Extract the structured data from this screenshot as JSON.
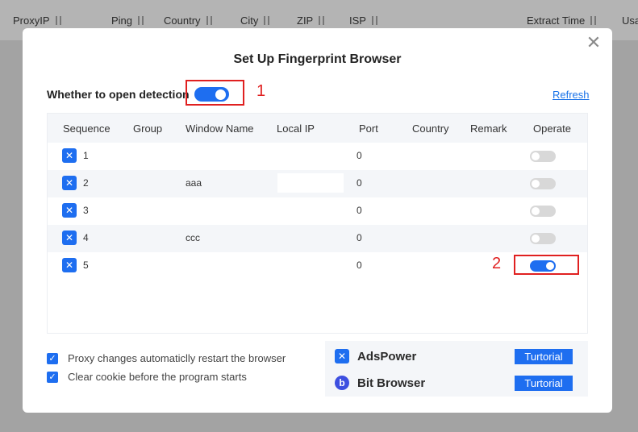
{
  "background": {
    "columns": [
      "ProxyIP",
      "Ping",
      "Country",
      "City",
      "ZIP",
      "ISP",
      "Extract Time",
      "Usa"
    ]
  },
  "modal": {
    "title": "Set Up Fingerprint Browser",
    "close_icon": "close-icon",
    "detection_label": "Whether to open detection",
    "detection_on": true,
    "refresh_label": "Refresh",
    "annotation_1": "1",
    "annotation_2": "2",
    "table": {
      "headers": [
        "Sequence",
        "Group",
        "Window Name",
        "Local IP",
        "Port",
        "Country",
        "Remark",
        "Operate"
      ],
      "rows": [
        {
          "seq": "1",
          "group": "",
          "window_name": "",
          "local_ip": "",
          "port": "0",
          "country": "",
          "remark": "",
          "enabled": false
        },
        {
          "seq": "2",
          "group": "",
          "window_name": "aaa",
          "local_ip": "",
          "port": "0",
          "country": "",
          "remark": "",
          "enabled": false
        },
        {
          "seq": "3",
          "group": "",
          "window_name": "",
          "local_ip": "",
          "port": "0",
          "country": "",
          "remark": "",
          "enabled": false
        },
        {
          "seq": "4",
          "group": "",
          "window_name": "ccc",
          "local_ip": "",
          "port": "0",
          "country": "",
          "remark": "",
          "enabled": false
        },
        {
          "seq": "5",
          "group": "",
          "window_name": "",
          "local_ip": "",
          "port": "0",
          "country": "",
          "remark": "",
          "enabled": true
        }
      ]
    },
    "options": [
      {
        "label": "Proxy changes automaticlly restart the browser",
        "checked": true
      },
      {
        "label": "Clear cookie before the program starts",
        "checked": true
      }
    ],
    "brands": [
      {
        "name": "AdsPower",
        "icon": "adspower-icon",
        "button": "Turtorial"
      },
      {
        "name": "Bit Browser",
        "icon": "bitbrowser-icon",
        "button": "Turtorial"
      }
    ]
  },
  "colors": {
    "accent": "#1e6ef0",
    "annotation": "#e02020"
  }
}
